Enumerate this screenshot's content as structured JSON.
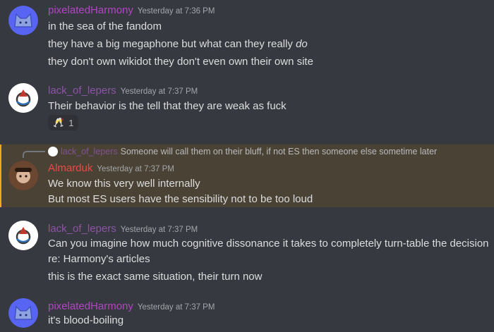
{
  "messages": [
    {
      "author": "pixelatedHarmony",
      "timestamp": "Yesterday at 7:36 PM",
      "lines": [
        "in the sea of the fandom",
        "they have a big megaphone but what can they really do",
        "they don't own wikidot they don't even own their own site"
      ]
    },
    {
      "author": "lack_of_lepers",
      "timestamp": "Yesterday at 7:37 PM",
      "lines": [
        "Their behavior is the tell that they are weak as fuck"
      ],
      "reaction": {
        "emoji": "🥂",
        "count": "1"
      }
    },
    {
      "reply": {
        "author": "lack_of_lepers",
        "text": "Someone will call them on their bluff, if not ES then someone else sometime later"
      },
      "author": "Almarduk",
      "timestamp": "Yesterday at 7:37 PM",
      "lines": [
        "We know this very well internally",
        "But most ES users have the sensibility not to be too loud"
      ]
    },
    {
      "author": "lack_of_lepers",
      "timestamp": "Yesterday at 7:37 PM",
      "lines": [
        "Can you imagine how much cognitive dissonance it takes to completely turn-table the decision",
        "re: Harmony's articles",
        "this is the exact same situation, their turn now"
      ]
    },
    {
      "author": "pixelatedHarmony",
      "timestamp": "Yesterday at 7:37 PM",
      "lines": [
        "it's blood-boiling"
      ]
    }
  ],
  "colors": {
    "background": "#36393f",
    "highlight": "#4a4234",
    "name_pixelated": "#b146c2",
    "name_lack": "#8a55a3",
    "name_almarduk": "#f04747"
  }
}
